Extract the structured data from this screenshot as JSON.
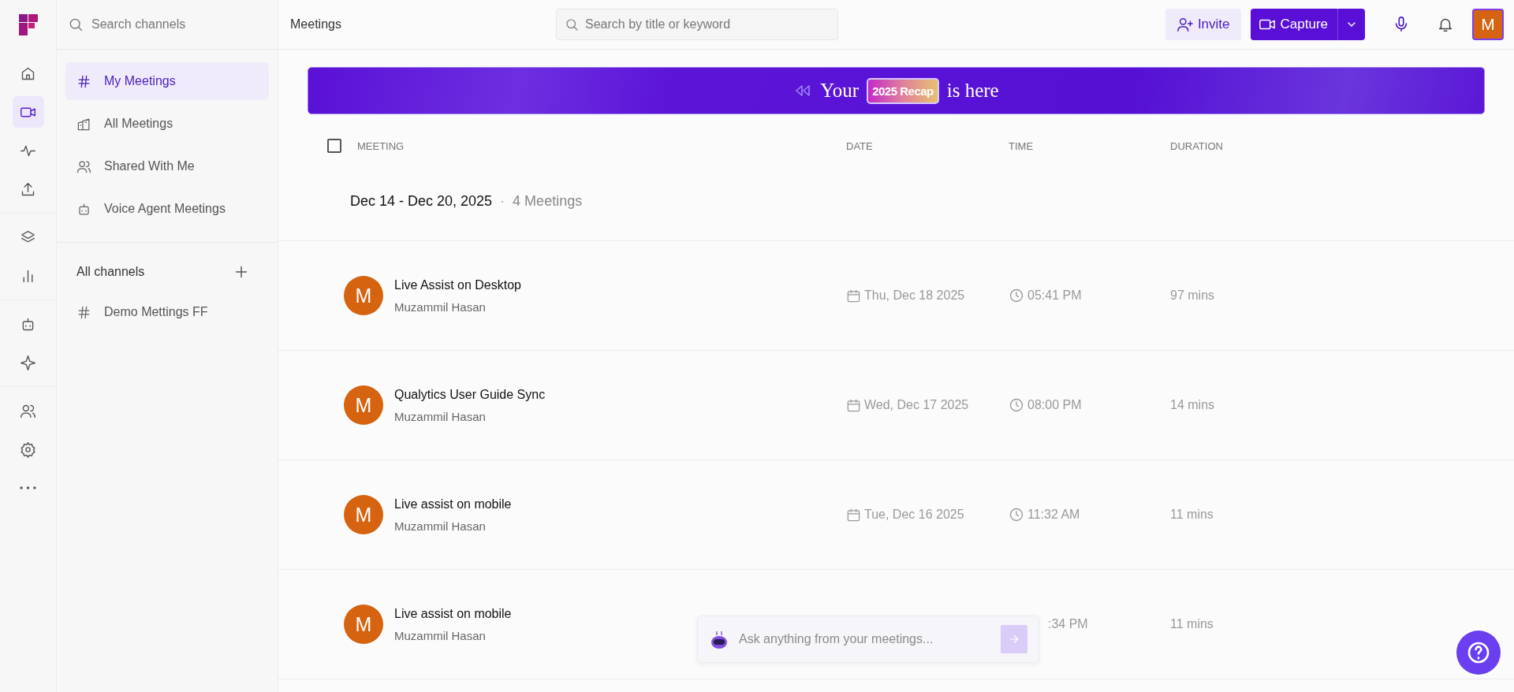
{
  "rail": {
    "groups": [
      [
        {
          "kind": "home",
          "selected": false
        },
        {
          "kind": "video",
          "selected": true
        },
        {
          "kind": "pulse",
          "selected": false
        },
        {
          "kind": "upload",
          "selected": false
        }
      ],
      [
        {
          "kind": "layers",
          "selected": false
        },
        {
          "kind": "bars",
          "selected": false
        }
      ],
      [
        {
          "kind": "bot",
          "selected": false
        },
        {
          "kind": "sparkle",
          "selected": false
        }
      ],
      [
        {
          "kind": "users",
          "selected": false
        },
        {
          "kind": "gear",
          "selected": false
        },
        {
          "kind": "more",
          "selected": false
        }
      ]
    ]
  },
  "sidebar": {
    "search": {
      "placeholder": "Search channels"
    },
    "items": [
      {
        "kind": "hash",
        "label": "My Meetings",
        "selected": true
      },
      {
        "kind": "building",
        "label": "All Meetings",
        "selected": false
      },
      {
        "kind": "users",
        "label": "Shared With Me",
        "selected": false
      },
      {
        "kind": "bot",
        "label": "Voice Agent Meetings",
        "selected": false
      }
    ],
    "channels_heading": "All channels",
    "channels": [
      {
        "kind": "hash",
        "label": "Demo Mettings FF",
        "selected": false
      }
    ]
  },
  "topbar": {
    "title": "Meetings",
    "search": {
      "placeholder": "Search by title or keyword"
    },
    "invite": "Invite",
    "capture": "Capture",
    "avatar": "M"
  },
  "banner": {
    "before": "Your",
    "badge": "2025 Recap",
    "after": "is here"
  },
  "table": {
    "select_all": {
      "checked": false
    },
    "columns": [
      "MEETING",
      "DATE",
      "TIME",
      "DURATION"
    ],
    "group": {
      "range": "Dec 14 - Dec 20, 2025",
      "separator": "·",
      "count": "4 Meetings"
    },
    "rows": [
      {
        "avatar": "M",
        "title": "Live Assist on Desktop",
        "owner": "Muzammil Hasan",
        "date": "Thu, Dec 18 2025",
        "time": "05:41 PM",
        "time_icon": true,
        "duration": "97 mins"
      },
      {
        "avatar": "M",
        "title": "Qualytics User Guide Sync",
        "owner": "Muzammil Hasan",
        "date": "Wed, Dec 17 2025",
        "time": "08:00 PM",
        "time_icon": true,
        "duration": "14 mins"
      },
      {
        "avatar": "M",
        "title": "Live assist on mobile",
        "owner": "Muzammil Hasan",
        "date": "Tue, Dec 16 2025",
        "time": "11:32 AM",
        "time_icon": true,
        "duration": "11 mins"
      },
      {
        "avatar": "M",
        "title": "Live assist on mobile",
        "owner": "Muzammil Hasan",
        "time": ":34 PM",
        "time_icon": false,
        "duration": "11 mins"
      }
    ]
  },
  "ask": {
    "placeholder": "Ask anything from your meetings..."
  }
}
